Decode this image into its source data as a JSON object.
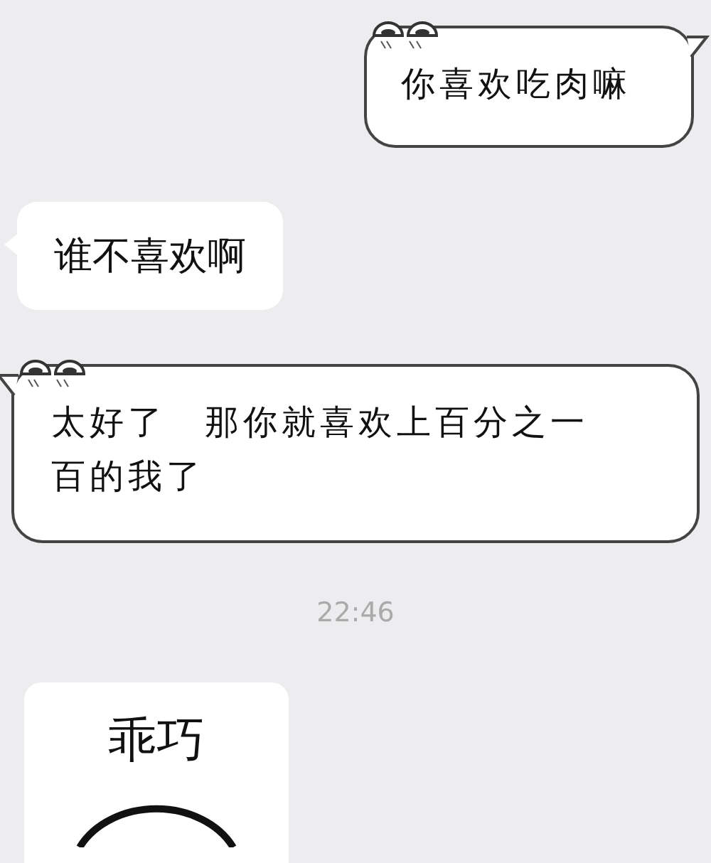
{
  "messages": [
    {
      "kind": "sticker-bubble",
      "outgoing": true,
      "text": "你喜欢吃肉嘛"
    },
    {
      "kind": "bubble",
      "outgoing": false,
      "text": "谁不喜欢啊"
    },
    {
      "kind": "sticker-bubble",
      "outgoing": false,
      "text": "太好了　那你就喜欢上百分之一百的我了"
    },
    {
      "kind": "time",
      "text": "22:46"
    },
    {
      "kind": "sticker-image",
      "outgoing": false,
      "text": "乖巧"
    }
  ]
}
